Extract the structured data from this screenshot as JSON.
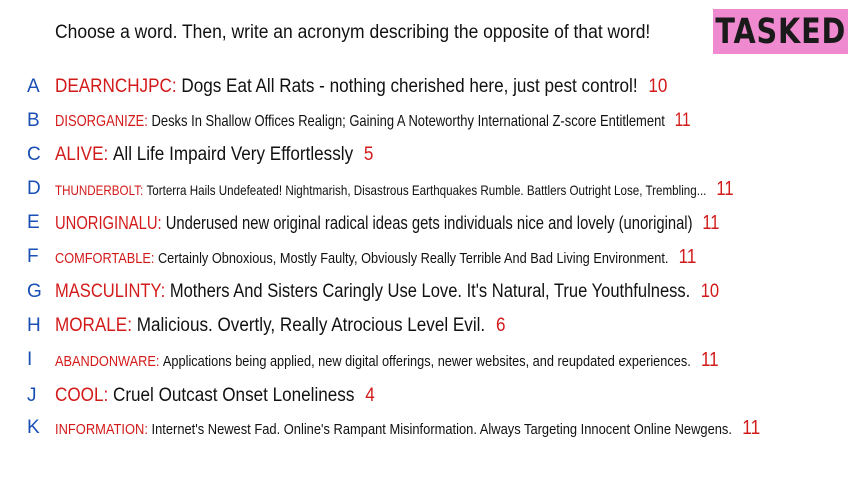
{
  "prompt": "Choose a word. Then, write an acronym describing the opposite of that word!",
  "logo": "TASKED",
  "answers": [
    {
      "letter": "A",
      "word": "DEARNCHJPC:",
      "acronym": "Dogs Eat All Rats - nothing cherished here, just pest control!",
      "score": "10"
    },
    {
      "letter": "B",
      "word": "DISORGANIZE:",
      "acronym": "Desks In Shallow Offices Realign; Gaining A Noteworthy International Z-score Entitlement",
      "score": "11"
    },
    {
      "letter": "C",
      "word": "ALIVE:",
      "acronym": "All Life Impaird Very Effortlessly",
      "score": "5"
    },
    {
      "letter": "D",
      "word": "THUNDERBOLT:",
      "acronym": "Torterra Hails Undefeated! Nightmarish, Disastrous Earthquakes Rumble. Battlers Outright Lose, Trembling...",
      "score": "11"
    },
    {
      "letter": "E",
      "word": "UNORIGINALU:",
      "acronym": "Underused new original radical ideas gets individuals nice and lovely (unoriginal)",
      "score": "11"
    },
    {
      "letter": "F",
      "word": "COMFORTABLE:",
      "acronym": "Certainly Obnoxious, Mostly Faulty, Obviously Really Terrible And Bad Living Environment.",
      "score": "11"
    },
    {
      "letter": "G",
      "word": "MASCULINTY:",
      "acronym": "Mothers And Sisters Caringly Use Love. It's Natural, True Youthfulness.",
      "score": "10"
    },
    {
      "letter": "H",
      "word": "MORALE:",
      "acronym": "Malicious. Overtly, Really Atrocious Level Evil.",
      "score": "6"
    },
    {
      "letter": "I",
      "word": "ABANDONWARE:",
      "acronym": "Applications being applied, new digital offerings, newer websites, and reupdated experiences.",
      "score": "11"
    },
    {
      "letter": "J",
      "word": "COOL:",
      "acronym": "Cruel Outcast Onset Loneliness",
      "score": "4"
    },
    {
      "letter": "K",
      "word": "INFORMATION:",
      "acronym": "Internet's Newest Fad. Online's Rampant Misinformation. Always Targeting Innocent Online Newgens.",
      "score": "11"
    }
  ]
}
